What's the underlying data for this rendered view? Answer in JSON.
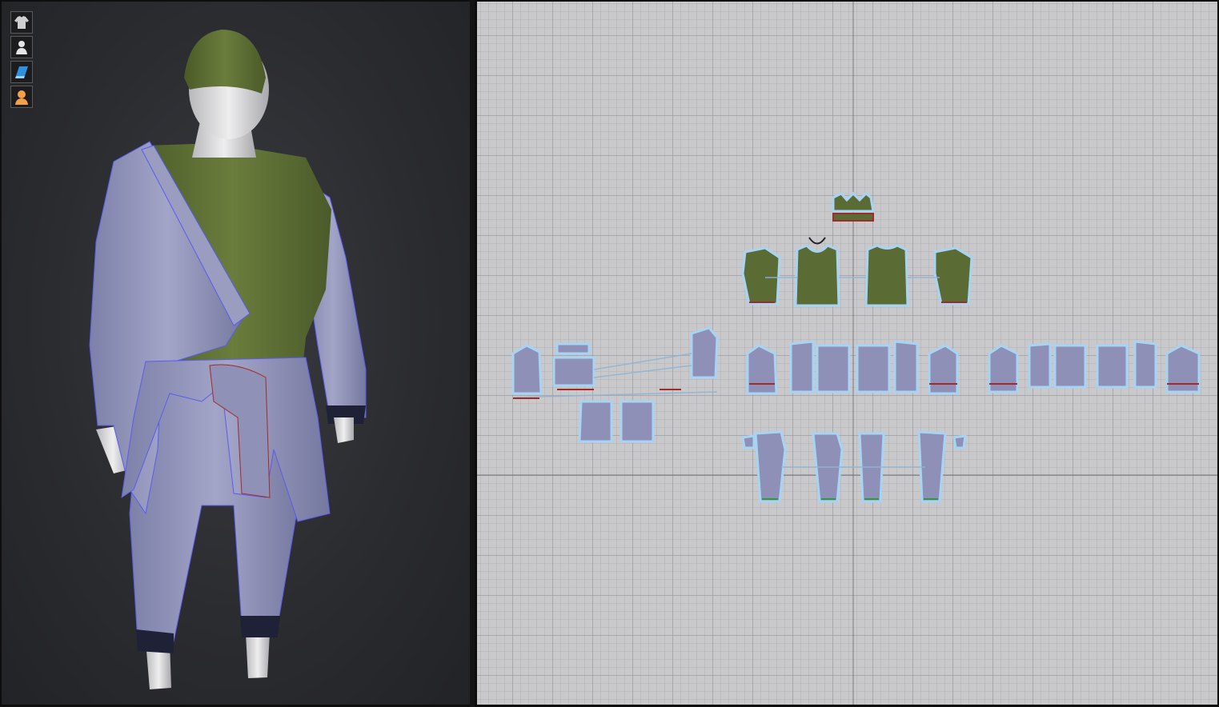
{
  "viewport3d": {
    "toolbar": [
      {
        "icon": "garment-visibility-icon"
      },
      {
        "icon": "avatar-visibility-icon"
      },
      {
        "icon": "texture-view-icon"
      },
      {
        "icon": "avatar-skin-icon"
      }
    ]
  },
  "viewport2d": {
    "grid": true,
    "axis_lines": true
  },
  "colors": {
    "fabric_lavender": "#8e90b8",
    "fabric_green": "#5a6b34",
    "fabric_navy": "#1f2236",
    "seam_red": "#a22a2a",
    "seam_blue": "#5a5cf0",
    "piece_outline": "#a8d4f4",
    "avatar_skin": "#d7d7d9"
  }
}
